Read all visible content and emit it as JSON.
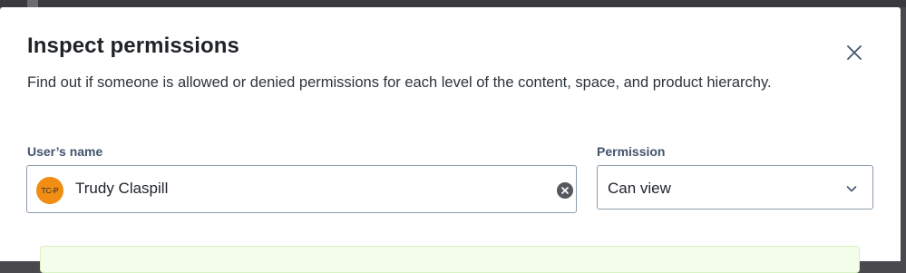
{
  "modal": {
    "title": "Inspect permissions",
    "description": "Find out if someone is allowed or denied permissions for each level of the content, space, and product hierarchy.",
    "close_icon": "close-icon"
  },
  "user_field": {
    "label": "User’s name",
    "avatar_initials": "TC-P",
    "avatar_color": "#f18d13",
    "value": "Trudy Claspill",
    "clear_icon": "clear-circle-icon"
  },
  "permission_field": {
    "label": "Permission",
    "selected": "Can view",
    "chevron_icon": "chevron-down-icon"
  },
  "colors": {
    "backdrop": "#4a4a4e",
    "result_panel_bg": "#f3fdea",
    "input_border": "#8c9bab"
  }
}
